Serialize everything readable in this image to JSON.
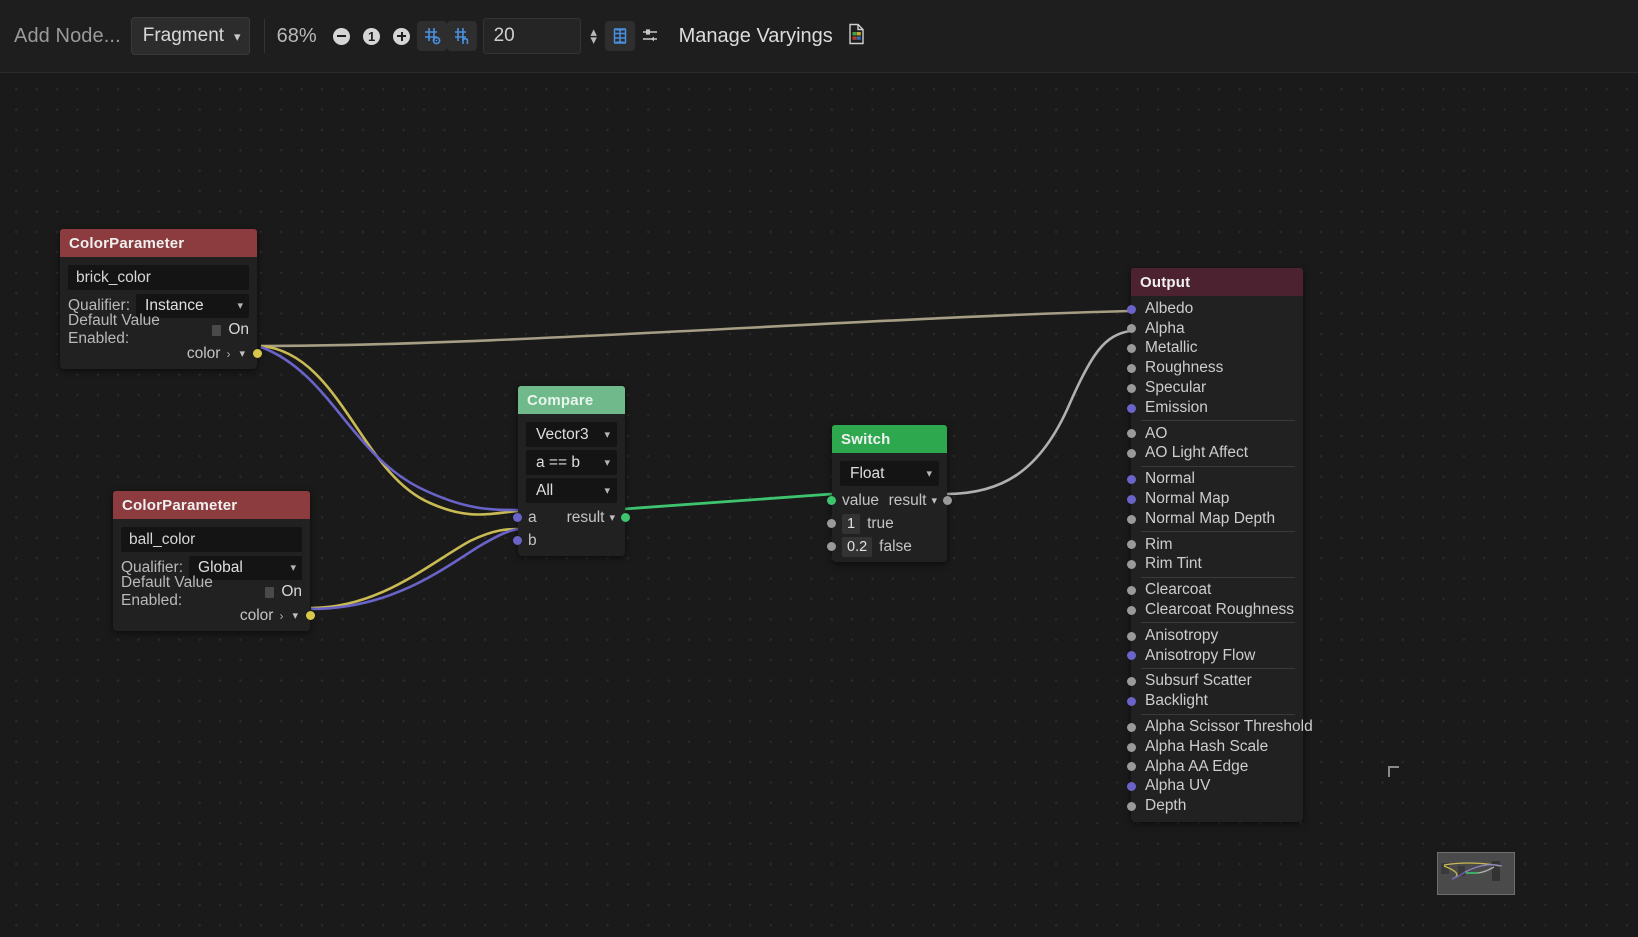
{
  "toolbar": {
    "add_node_label": "Add Node...",
    "shader_stage": "Fragment",
    "zoom_level": "68%",
    "zoom_out_icon": "zoom-out-icon",
    "zoom_reset_icon": "zoom-reset-icon",
    "zoom_in_icon": "zoom-in-icon",
    "snap_to_grid_icon": "snap-to-grid-icon",
    "grid_pattern_icon": "grid-pattern-icon",
    "grid_size_value": "20",
    "grid_visible_icon": "grid-visible-icon",
    "minimap_icon": "minimap-toggle-icon",
    "manage_varyings_label": "Manage Varyings",
    "doc_icon": "document-icon"
  },
  "nodes": {
    "brick_color": {
      "title": "ColorParameter",
      "header_color": "#8c3c3e",
      "name_value": "brick_color",
      "qualifier_label": "Qualifier:",
      "qualifier_value": "Instance",
      "default_label": "Default Value Enabled:",
      "default_state": "On",
      "output_port": "color",
      "port_color": "#d8c84a"
    },
    "ball_color": {
      "title": "ColorParameter",
      "header_color": "#8c3c3e",
      "name_value": "ball_color",
      "qualifier_label": "Qualifier:",
      "qualifier_value": "Global",
      "default_label": "Default Value Enabled:",
      "default_state": "On",
      "output_port": "color",
      "port_color": "#d8c84a"
    },
    "compare": {
      "title": "Compare",
      "header_color": "#6fb98a",
      "type_value": "Vector3",
      "condition_value": "a == b",
      "mode_value": "All",
      "input_a": "a",
      "input_b": "b",
      "output_result": "result",
      "port_color_in": "#6a63c8",
      "port_color_out": "#3ec46e"
    },
    "switch": {
      "title": "Switch",
      "header_color": "#2ea84f",
      "type_value": "Float",
      "input_value_label": "value",
      "output_result": "result",
      "true_number": "1",
      "true_label": "true",
      "false_number": "0.2",
      "false_label": "false",
      "port_color_value": "#3ec46e",
      "port_color_in": "#9a9a9a",
      "port_color_out": "#9a9a9a"
    },
    "output": {
      "title": "Output",
      "header_color": "#4d2230",
      "groups": [
        {
          "items": [
            {
              "label": "Albedo",
              "port_color": "#6a63c8"
            },
            {
              "label": "Alpha",
              "port_color": "#9a9a9a"
            },
            {
              "label": "Metallic",
              "port_color": "#9a9a9a"
            },
            {
              "label": "Roughness",
              "port_color": "#9a9a9a"
            },
            {
              "label": "Specular",
              "port_color": "#9a9a9a"
            },
            {
              "label": "Emission",
              "port_color": "#6a63c8"
            }
          ]
        },
        {
          "items": [
            {
              "label": "AO",
              "port_color": "#9a9a9a"
            },
            {
              "label": "AO Light Affect",
              "port_color": "#9a9a9a"
            }
          ]
        },
        {
          "items": [
            {
              "label": "Normal",
              "port_color": "#6a63c8"
            },
            {
              "label": "Normal Map",
              "port_color": "#6a63c8"
            },
            {
              "label": "Normal Map Depth",
              "port_color": "#9a9a9a"
            }
          ]
        },
        {
          "items": [
            {
              "label": "Rim",
              "port_color": "#9a9a9a"
            },
            {
              "label": "Rim Tint",
              "port_color": "#9a9a9a"
            }
          ]
        },
        {
          "items": [
            {
              "label": "Clearcoat",
              "port_color": "#9a9a9a"
            },
            {
              "label": "Clearcoat Roughness",
              "port_color": "#9a9a9a"
            }
          ]
        },
        {
          "items": [
            {
              "label": "Anisotropy",
              "port_color": "#9a9a9a"
            },
            {
              "label": "Anisotropy Flow",
              "port_color": "#6a63c8"
            }
          ]
        },
        {
          "items": [
            {
              "label": "Subsurf Scatter",
              "port_color": "#9a9a9a"
            },
            {
              "label": "Backlight",
              "port_color": "#6a63c8"
            }
          ]
        },
        {
          "items": [
            {
              "label": "Alpha Scissor Threshold",
              "port_color": "#9a9a9a"
            },
            {
              "label": "Alpha Hash Scale",
              "port_color": "#9a9a9a"
            },
            {
              "label": "Alpha AA Edge",
              "port_color": "#9a9a9a"
            },
            {
              "label": "Alpha UV",
              "port_color": "#6a63c8"
            },
            {
              "label": "Depth",
              "port_color": "#9a9a9a"
            }
          ]
        }
      ]
    }
  },
  "wire_colors": {
    "yellow": "#c9ba54",
    "gray": "#b0b0b0",
    "purple": "#6a63c8",
    "green": "#3ec46e"
  }
}
